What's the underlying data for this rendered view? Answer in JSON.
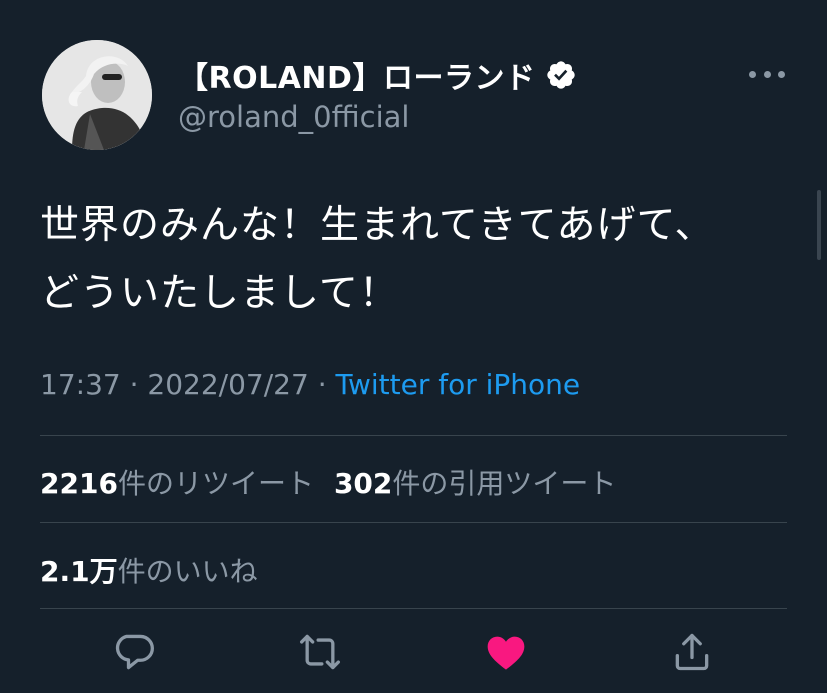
{
  "user": {
    "display_name": "【ROLAND】ローランド",
    "handle": "@roland_0fficial",
    "verified": true
  },
  "tweet": {
    "lines": [
      "世界のみんな！生まれてきてあげて、",
      "どういたしまして！"
    ]
  },
  "meta": {
    "time": "17:37",
    "separator": " · ",
    "date": "2022/07/27",
    "source": "Twitter for iPhone"
  },
  "stats": {
    "retweets_count": "2216",
    "retweets_label": "件のリツイート",
    "quotes_count": "302",
    "quotes_label": "件の引用ツイート",
    "likes_count": "2.1万",
    "likes_label": "件のいいね"
  },
  "actions": {
    "reply": "reply-icon",
    "retweet": "retweet-icon",
    "like": "heart-icon",
    "share": "share-icon"
  },
  "colors": {
    "background": "#15202b",
    "text": "#ffffff",
    "secondary": "#8b98a5",
    "link": "#1d9bf0",
    "like": "#f91880",
    "divider": "#38444d"
  }
}
